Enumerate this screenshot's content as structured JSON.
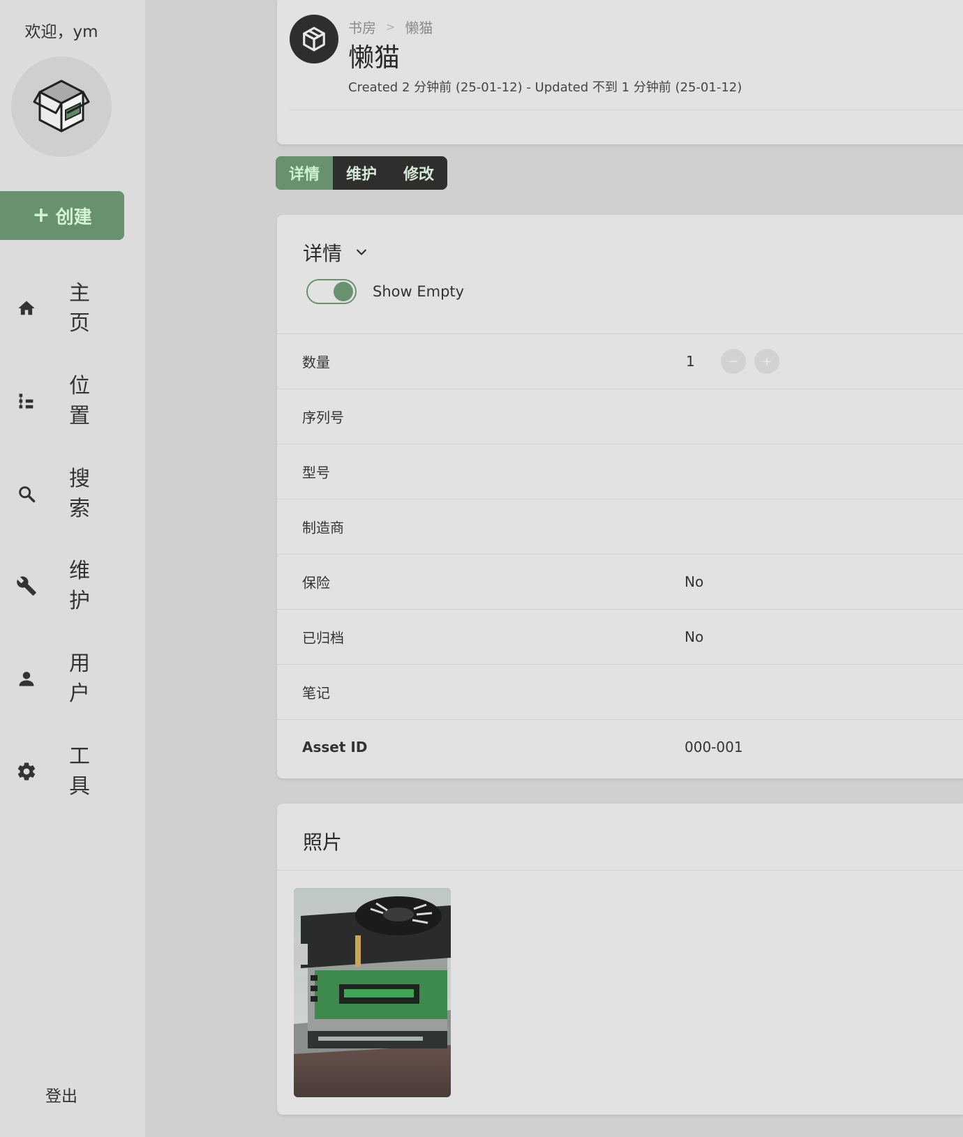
{
  "sidebar": {
    "welcome": "欢迎，ym",
    "create_label": "创建",
    "nav": [
      {
        "label": "主页",
        "icon": "home-icon"
      },
      {
        "label": "位置",
        "icon": "tree-icon"
      },
      {
        "label": "搜索",
        "icon": "search-icon"
      },
      {
        "label": "维护",
        "icon": "wrench-icon"
      },
      {
        "label": "用户",
        "icon": "person-icon"
      },
      {
        "label": "工具",
        "icon": "gear-icon"
      }
    ],
    "logout": "登出"
  },
  "header": {
    "breadcrumb": [
      "书房",
      "懒猫"
    ],
    "title": "懒猫",
    "timestamps": "Created 2 分钟前 (25-01-12) - Updated 不到 1 分钟前 (25-01-12)"
  },
  "tabs": [
    "详情",
    "维护",
    "修改"
  ],
  "details": {
    "title": "详情",
    "toggle_label": "Show Empty",
    "toggle_on": true,
    "rows": [
      {
        "key": "数量",
        "value": "1"
      },
      {
        "key": "序列号",
        "value": ""
      },
      {
        "key": "型号",
        "value": ""
      },
      {
        "key": "制造商",
        "value": ""
      },
      {
        "key": "保险",
        "value": "No"
      },
      {
        "key": "已归档",
        "value": "No"
      },
      {
        "key": "笔记",
        "value": ""
      },
      {
        "key": "Asset ID",
        "value": "000-001"
      }
    ]
  },
  "photos": {
    "title": "照片"
  },
  "colors": {
    "accent": "#68916f",
    "dark": "#2e2e2c",
    "card": "#e2e2e2"
  }
}
